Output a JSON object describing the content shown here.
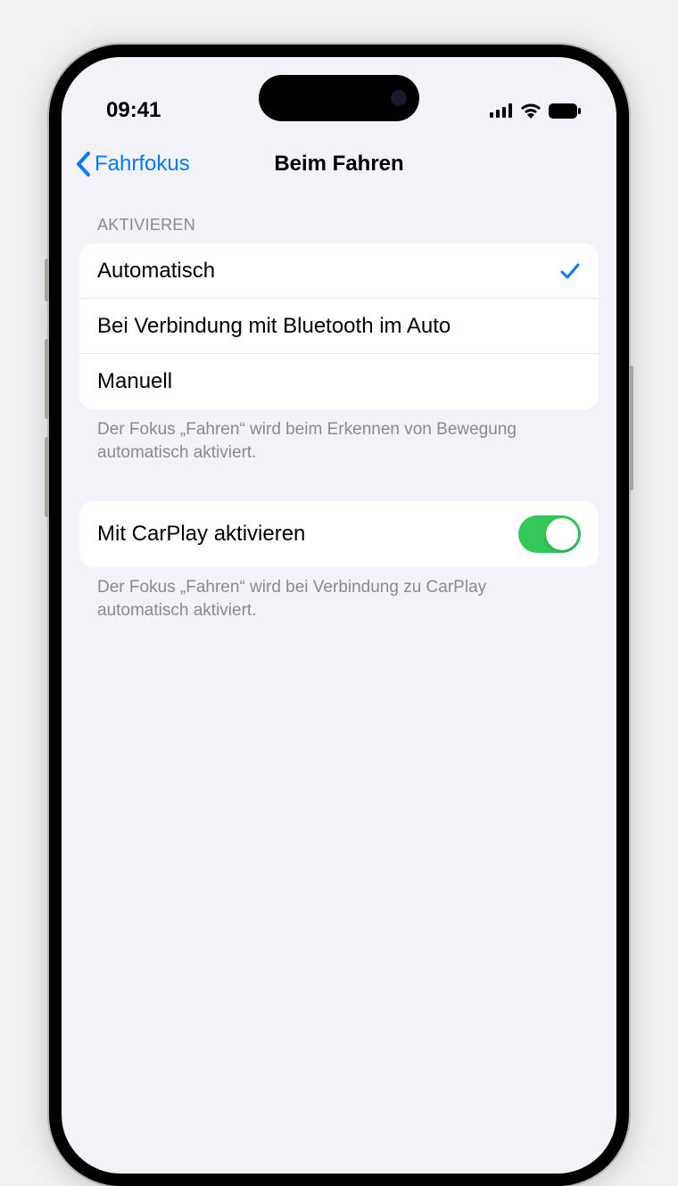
{
  "status": {
    "time": "09:41"
  },
  "nav": {
    "back_label": "Fahrfokus",
    "title": "Beim Fahren"
  },
  "activate": {
    "header": "Aktivieren",
    "options": [
      {
        "label": "Automatisch",
        "selected": true
      },
      {
        "label": "Bei Verbindung mit Bluetooth im Auto",
        "selected": false
      },
      {
        "label": "Manuell",
        "selected": false
      }
    ],
    "footer": "Der Fokus „Fahren“ wird beim Erkennen von Bewegung automatisch aktiviert."
  },
  "carplay": {
    "label": "Mit CarPlay aktivieren",
    "enabled": true,
    "footer": "Der Fokus „Fahren“ wird bei Verbindung zu CarPlay automatisch aktiviert."
  },
  "colors": {
    "accent": "#007aff",
    "toggle_on": "#34c759"
  }
}
